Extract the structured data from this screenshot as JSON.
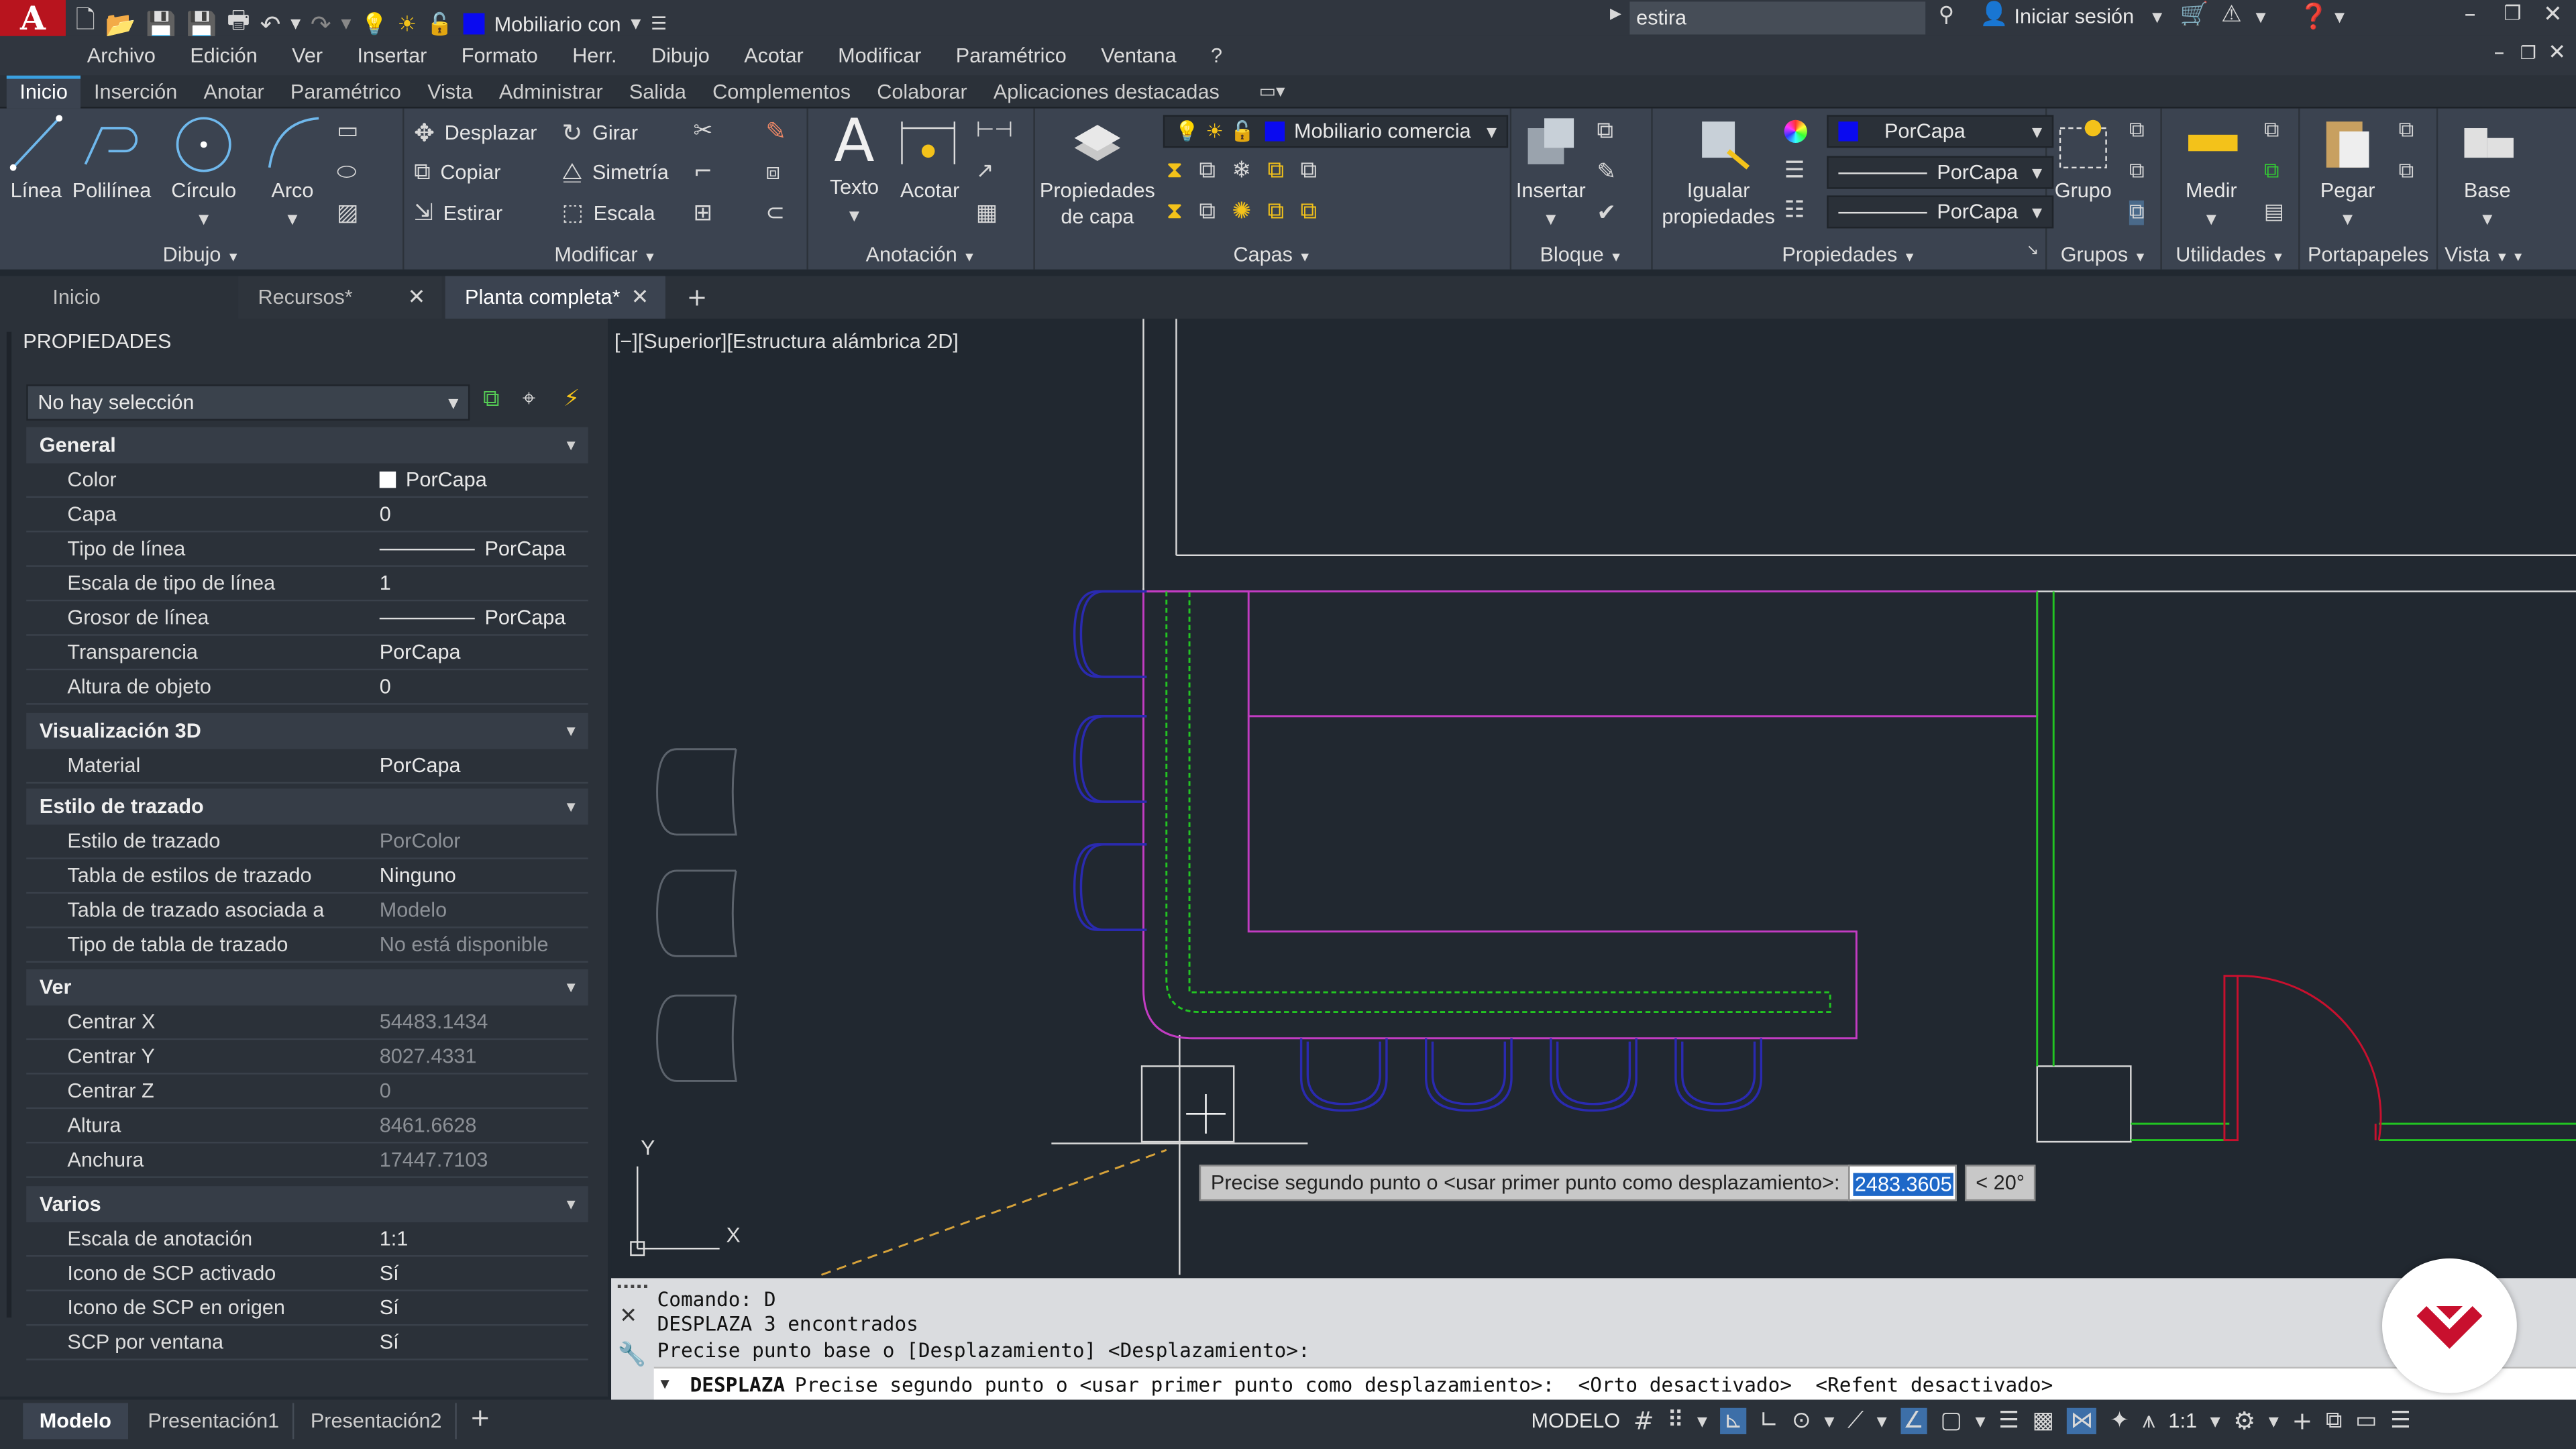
{
  "titlebar": {
    "app_logo": "A",
    "layer_name": "Mobiliario con",
    "search_value": "estira",
    "signin_label": "Iniciar sesión"
  },
  "menubar": [
    "Archivo",
    "Edición",
    "Ver",
    "Insertar",
    "Formato",
    "Herr.",
    "Dibujo",
    "Acotar",
    "Modificar",
    "Paramétrico",
    "Ventana",
    "?"
  ],
  "ribbon_tabs": [
    "Inicio",
    "Inserción",
    "Anotar",
    "Paramétrico",
    "Vista",
    "Administrar",
    "Salida",
    "Complementos",
    "Colaborar",
    "Aplicaciones destacadas"
  ],
  "ribbon": {
    "dibujo": {
      "title": "Dibujo",
      "linea": "Línea",
      "polilinea": "Polilínea",
      "circulo": "Círculo",
      "arco": "Arco"
    },
    "modificar": {
      "title": "Modificar",
      "desplazar": "Desplazar",
      "girar": "Girar",
      "copiar": "Copiar",
      "simetria": "Simetría",
      "estirar": "Estirar",
      "escala": "Escala"
    },
    "anotacion": {
      "title": "Anotación",
      "texto": "Texto",
      "acotar": "Acotar"
    },
    "capas": {
      "title": "Capas",
      "prop_line1": "Propiedades",
      "prop_line2": "de capa",
      "layer_dropdown": "Mobiliario comercia"
    },
    "bloque": {
      "title": "Bloque",
      "insertar": "Insertar"
    },
    "propiedades": {
      "title": "Propiedades",
      "igualar1": "Igualar",
      "igualar2": "propiedades",
      "color": "PorCapa",
      "linetype": "PorCapa",
      "lineweight": "PorCapa"
    },
    "grupos": {
      "title": "Grupos",
      "grupo": "Grupo"
    },
    "utilidades": {
      "title": "Utilidades",
      "medir": "Medir"
    },
    "portapapeles": {
      "title": "Portapapeles",
      "pegar": "Pegar"
    },
    "vista": {
      "title": "Vista",
      "base": "Base"
    }
  },
  "file_tabs": [
    "Inicio",
    "Recursos*",
    "Planta completa*"
  ],
  "properties": {
    "title": "PROPIEDADES",
    "selection": "No hay selección",
    "sections": {
      "general": "General",
      "vis3d": "Visualización 3D",
      "estilo": "Estilo de trazado",
      "ver": "Ver",
      "varios": "Varios"
    },
    "general": [
      {
        "k": "Color",
        "v": "PorCapa"
      },
      {
        "k": "Capa",
        "v": "0"
      },
      {
        "k": "Tipo de línea",
        "v": "PorCapa"
      },
      {
        "k": "Escala de tipo de línea",
        "v": "1"
      },
      {
        "k": "Grosor de línea",
        "v": "PorCapa"
      },
      {
        "k": "Transparencia",
        "v": "PorCapa"
      },
      {
        "k": "Altura de objeto",
        "v": "0"
      }
    ],
    "vis3d": [
      {
        "k": "Material",
        "v": "PorCapa"
      }
    ],
    "estilo": [
      {
        "k": "Estilo de trazado",
        "v": "PorColor"
      },
      {
        "k": "Tabla de estilos de trazado",
        "v": "Ninguno"
      },
      {
        "k": "Tabla de trazado asociada a",
        "v": "Modelo"
      },
      {
        "k": "Tipo de tabla de trazado",
        "v": "No está disponible"
      }
    ],
    "ver": [
      {
        "k": "Centrar X",
        "v": "54483.1434"
      },
      {
        "k": "Centrar Y",
        "v": "8027.4331"
      },
      {
        "k": "Centrar Z",
        "v": "0"
      },
      {
        "k": "Altura",
        "v": "8461.6628"
      },
      {
        "k": "Anchura",
        "v": "17447.7103"
      }
    ],
    "varios": [
      {
        "k": "Escala de anotación",
        "v": "1:1"
      },
      {
        "k": "Icono de SCP activado",
        "v": "Sí"
      },
      {
        "k": "Icono de SCP en origen",
        "v": "Sí"
      },
      {
        "k": "SCP por ventana",
        "v": "Sí"
      }
    ]
  },
  "viewport": {
    "label": "[−][Superior][Estructura alámbrica 2D]",
    "tooltip": "Precise segundo punto o <usar primer punto como desplazamiento>:",
    "distance": "2483.3605",
    "angle": "< 20°",
    "ucs_y": "Y",
    "ucs_x": "X"
  },
  "command": {
    "line1": "Comando: D",
    "line2": "DESPLAZA 3 encontrados",
    "line3": "Precise punto base o [Desplazamiento] <Desplazamiento>:",
    "prompt_cmd": "DESPLAZA",
    "prompt_text": "Precise segundo punto o <usar primer punto como desplazamiento>:  <Orto desactivado>  <Refent desactivado>"
  },
  "layout_tabs": [
    "Modelo",
    "Presentación1",
    "Presentación2"
  ],
  "status": {
    "model": "MODELO",
    "scale": "1:1"
  },
  "colors": {
    "accent": "#3aa0e0",
    "magenta": "#c23cc2",
    "green": "#22b422",
    "blue": "#2a2aa8",
    "red": "#c8102e"
  }
}
